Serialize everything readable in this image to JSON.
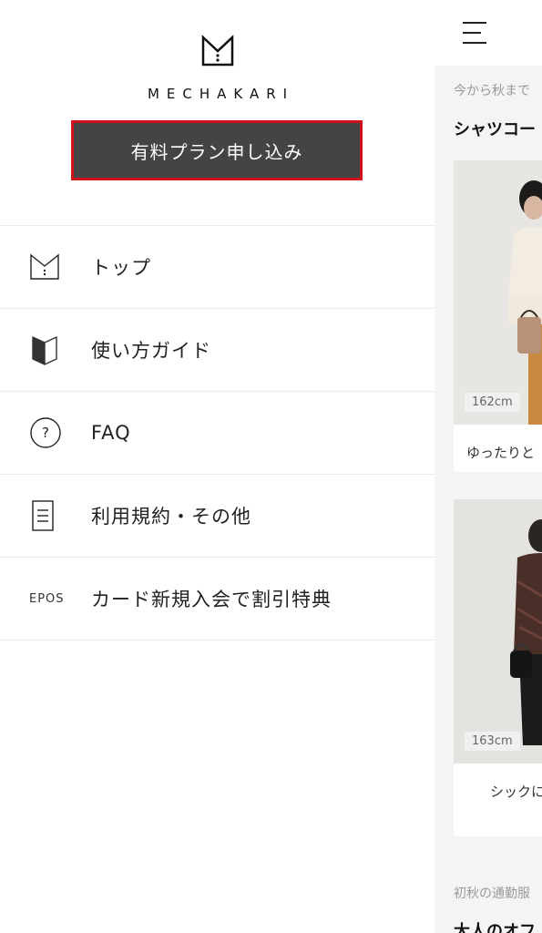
{
  "drawer": {
    "brand": "MECHAKARI",
    "cta_label": "有料プラン申し込み",
    "menu": [
      {
        "label": "トップ",
        "icon": "mechakari-logo-icon"
      },
      {
        "label": "使い方ガイド",
        "icon": "beginner-mark-icon"
      },
      {
        "label": "FAQ",
        "icon": "question-circle-icon"
      },
      {
        "label": "利用規約・その他",
        "icon": "document-icon"
      },
      {
        "label": "カード新規入会で割引特典",
        "icon": "epos-logo-icon",
        "icon_text": "EPOS"
      }
    ]
  },
  "background": {
    "note1": "今から秋まで",
    "heading1": "シャツコー",
    "card1": {
      "height": "162cm",
      "caption": "ゆったりと"
    },
    "card2": {
      "height": "163cm",
      "caption": "シックに"
    },
    "note2": "初秋の通勤服",
    "heading2": "大人のオフ"
  },
  "colors": {
    "cta_bg": "#444444",
    "cta_border": "#d0121b"
  }
}
